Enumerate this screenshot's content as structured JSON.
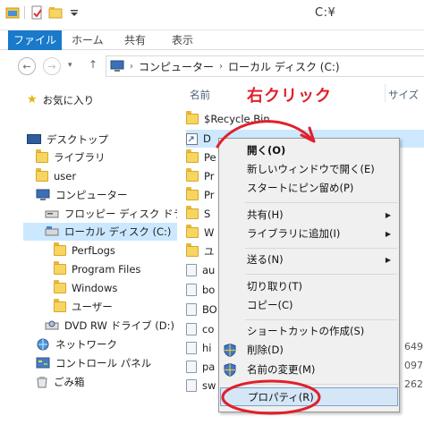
{
  "window": {
    "title": "C:¥"
  },
  "ribbon": {
    "tabs": [
      "ファイル",
      "ホーム",
      "共有",
      "表示"
    ]
  },
  "address": {
    "segments": [
      "コンピューター",
      "ローカル ディスク (C:)"
    ]
  },
  "nav_pane": {
    "favorites": "お気に入り",
    "desktop": "デスクトップ",
    "library": "ライブラリ",
    "user": "user",
    "computer": "コンピューター",
    "floppy": "フロッピー ディスク ドライブ",
    "local_disk": "ローカル ディスク (C:)",
    "perflogs": "PerfLogs",
    "program_files": "Program Files",
    "windows": "Windows",
    "users": "ユーザー",
    "dvd": "DVD RW ドライブ (D:)",
    "network": "ネットワーク",
    "control_panel": "コントロール パネル",
    "recycle": "ごみ箱"
  },
  "file_list": {
    "col_name": "名前",
    "col_size": "サイズ",
    "rows": [
      {
        "name": "$Recycle.Bin",
        "size": ""
      },
      {
        "name": "D",
        "size": ""
      },
      {
        "name": "Pe",
        "size": ""
      },
      {
        "name": "Pr",
        "size": ""
      },
      {
        "name": "Pr",
        "size": ""
      },
      {
        "name": "S",
        "size": ""
      },
      {
        "name": "W",
        "size": ""
      },
      {
        "name": "ユ",
        "size": ""
      },
      {
        "name": "au",
        "size": ""
      },
      {
        "name": "bo",
        "size": ""
      },
      {
        "name": "BO",
        "size": ""
      },
      {
        "name": "co",
        "size": ""
      },
      {
        "name": "hi",
        "size": "649"
      },
      {
        "name": "pa",
        "size": "097"
      },
      {
        "name": "sw",
        "size": "262"
      }
    ]
  },
  "context_menu": {
    "open": "開く(O)",
    "open_new": "新しいウィンドウで開く(E)",
    "pin_start": "スタートにピン留め(P)",
    "share": "共有(H)",
    "add_library": "ライブラリに追加(I)",
    "send_to": "送る(N)",
    "cut": "切り取り(T)",
    "copy": "コピー(C)",
    "create_shortcut": "ショートカットの作成(S)",
    "delete": "削除(D)",
    "rename": "名前の変更(M)",
    "properties": "プロパティ(R)"
  },
  "annotation": {
    "text": "右クリック",
    "color": "#e0202b"
  },
  "colors": {
    "accent": "#1979ca",
    "selection": "#cce8ff",
    "menu_bg": "#f0f0f0"
  }
}
